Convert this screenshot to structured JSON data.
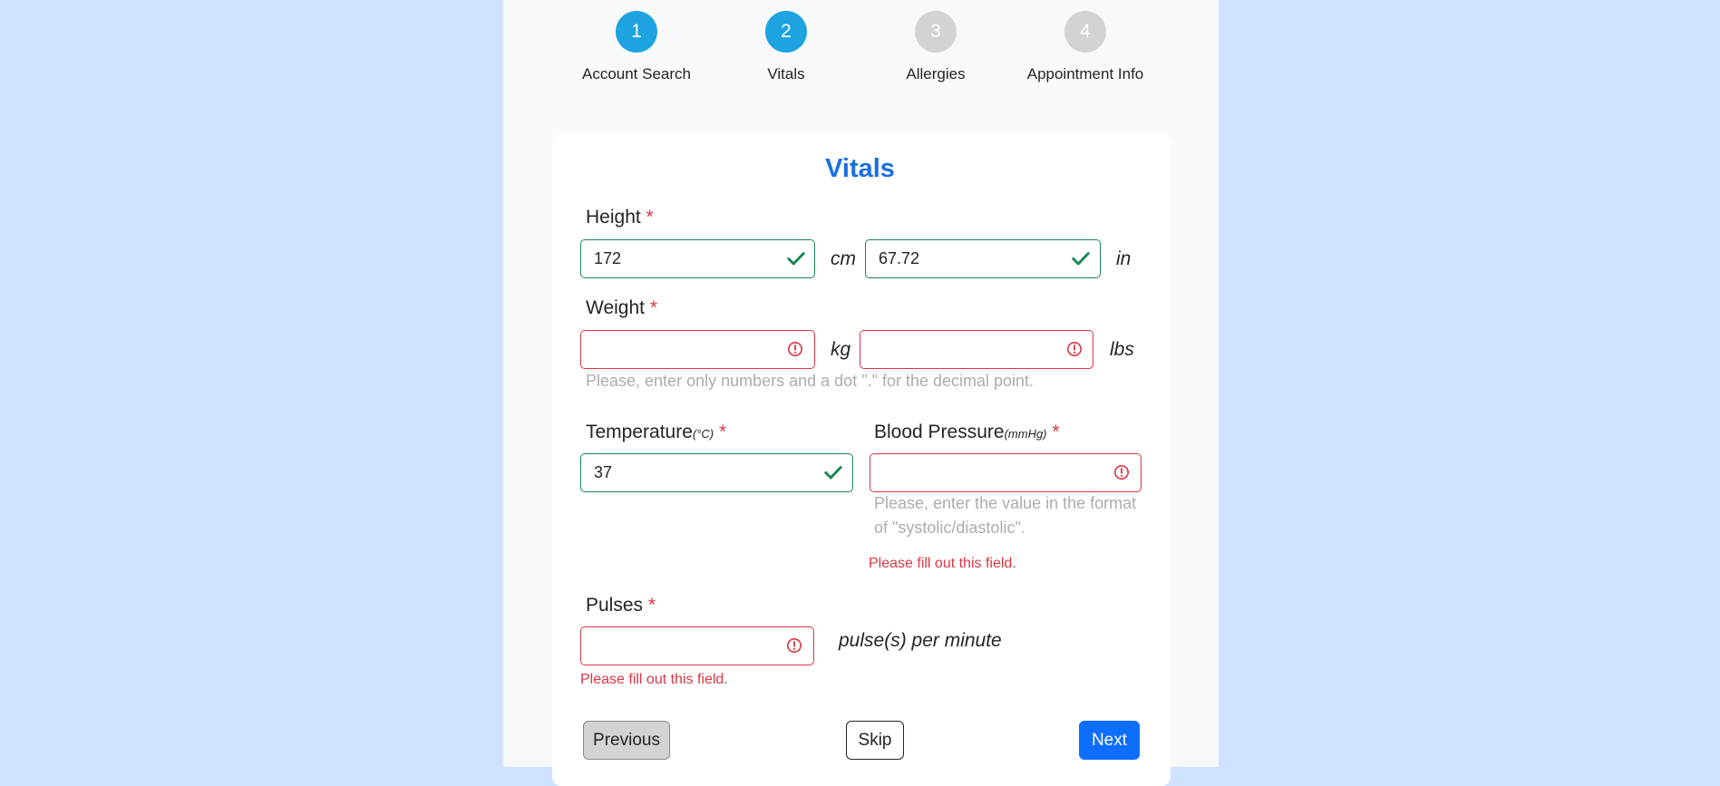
{
  "steps": [
    {
      "number": "1",
      "label": "Account Search",
      "state": "active"
    },
    {
      "number": "2",
      "label": "Vitals",
      "state": "active"
    },
    {
      "number": "3",
      "label": "Allergies",
      "state": "inactive"
    },
    {
      "number": "4",
      "label": "Appointment Info",
      "state": "inactive"
    }
  ],
  "form": {
    "title": "Vitals",
    "required_mark": "*",
    "height": {
      "label": "Height",
      "cm_value": "172",
      "cm_unit": "cm",
      "in_value": "67.72",
      "in_unit": "in"
    },
    "weight": {
      "label": "Weight",
      "kg_value": "",
      "kg_unit": "kg",
      "lbs_value": "",
      "lbs_unit": "lbs",
      "hint": "Please, enter only numbers and a dot \".\" for the decimal point."
    },
    "temperature": {
      "label": "Temperature",
      "unit": "(°C)",
      "value": "37"
    },
    "blood_pressure": {
      "label": "Blood Pressure",
      "unit": "(mmHg)",
      "value": "",
      "hint_line1": "Please, enter the value in the format",
      "hint_line2": "of \"systolic/diastolic\".",
      "error": "Please fill out this field."
    },
    "pulses": {
      "label": "Pulses",
      "value": "",
      "unit": "pulse(s) per minute",
      "error": "Please fill out this field."
    }
  },
  "buttons": {
    "previous": "Previous",
    "skip": "Skip",
    "next": "Next"
  },
  "colors": {
    "valid": "#198754",
    "invalid": "#dc3545",
    "accent": "#1ca3e0",
    "primary": "#0d6efd"
  }
}
